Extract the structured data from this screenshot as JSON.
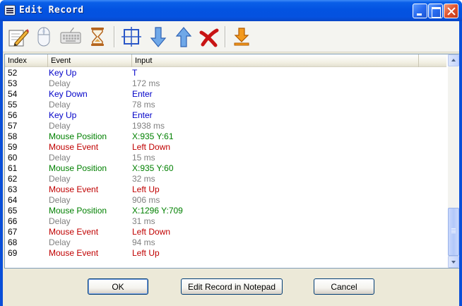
{
  "window": {
    "title": "Edit Record"
  },
  "toolbar": {
    "buttons": [
      {
        "name": "edit-pencil-icon"
      },
      {
        "name": "mouse-icon"
      },
      {
        "name": "keyboard-icon"
      },
      {
        "name": "hourglass-icon"
      },
      {
        "name": "select-region-icon"
      },
      {
        "name": "move-down-icon"
      },
      {
        "name": "move-up-icon"
      },
      {
        "name": "delete-icon"
      },
      {
        "name": "insert-download-icon"
      }
    ]
  },
  "list": {
    "columns": [
      "Index",
      "Event",
      "Input"
    ],
    "rows": [
      {
        "index": "52",
        "event": "Key Up",
        "input": "T",
        "type": "key"
      },
      {
        "index": "53",
        "event": "Delay",
        "input": "172 ms",
        "type": "delay"
      },
      {
        "index": "54",
        "event": "Key Down",
        "input": "Enter",
        "type": "key"
      },
      {
        "index": "55",
        "event": "Delay",
        "input": "78 ms",
        "type": "delay"
      },
      {
        "index": "56",
        "event": "Key Up",
        "input": "Enter",
        "type": "key"
      },
      {
        "index": "57",
        "event": "Delay",
        "input": "1938 ms",
        "type": "delay"
      },
      {
        "index": "58",
        "event": "Mouse Position",
        "input": "X:935 Y:61",
        "type": "pos"
      },
      {
        "index": "59",
        "event": "Mouse Event",
        "input": "Left Down",
        "type": "mouse"
      },
      {
        "index": "60",
        "event": "Delay",
        "input": "15 ms",
        "type": "delay"
      },
      {
        "index": "61",
        "event": "Mouse Position",
        "input": "X:935 Y:60",
        "type": "pos"
      },
      {
        "index": "62",
        "event": "Delay",
        "input": "32 ms",
        "type": "delay"
      },
      {
        "index": "63",
        "event": "Mouse Event",
        "input": "Left Up",
        "type": "mouse"
      },
      {
        "index": "64",
        "event": "Delay",
        "input": "906 ms",
        "type": "delay"
      },
      {
        "index": "65",
        "event": "Mouse Position",
        "input": "X:1296 Y:709",
        "type": "pos"
      },
      {
        "index": "66",
        "event": "Delay",
        "input": "31 ms",
        "type": "delay"
      },
      {
        "index": "67",
        "event": "Mouse Event",
        "input": "Left Down",
        "type": "mouse"
      },
      {
        "index": "68",
        "event": "Delay",
        "input": "94 ms",
        "type": "delay"
      },
      {
        "index": "69",
        "event": "Mouse Event",
        "input": "Left Up",
        "type": "mouse"
      }
    ]
  },
  "colors": {
    "key": "#0000c8",
    "delay": "#808080",
    "pos": "#008000",
    "mouse": "#c00000"
  },
  "buttons": {
    "ok_label": "OK",
    "notepad_label": "Edit Record in Notepad",
    "cancel_label": "Cancel"
  }
}
